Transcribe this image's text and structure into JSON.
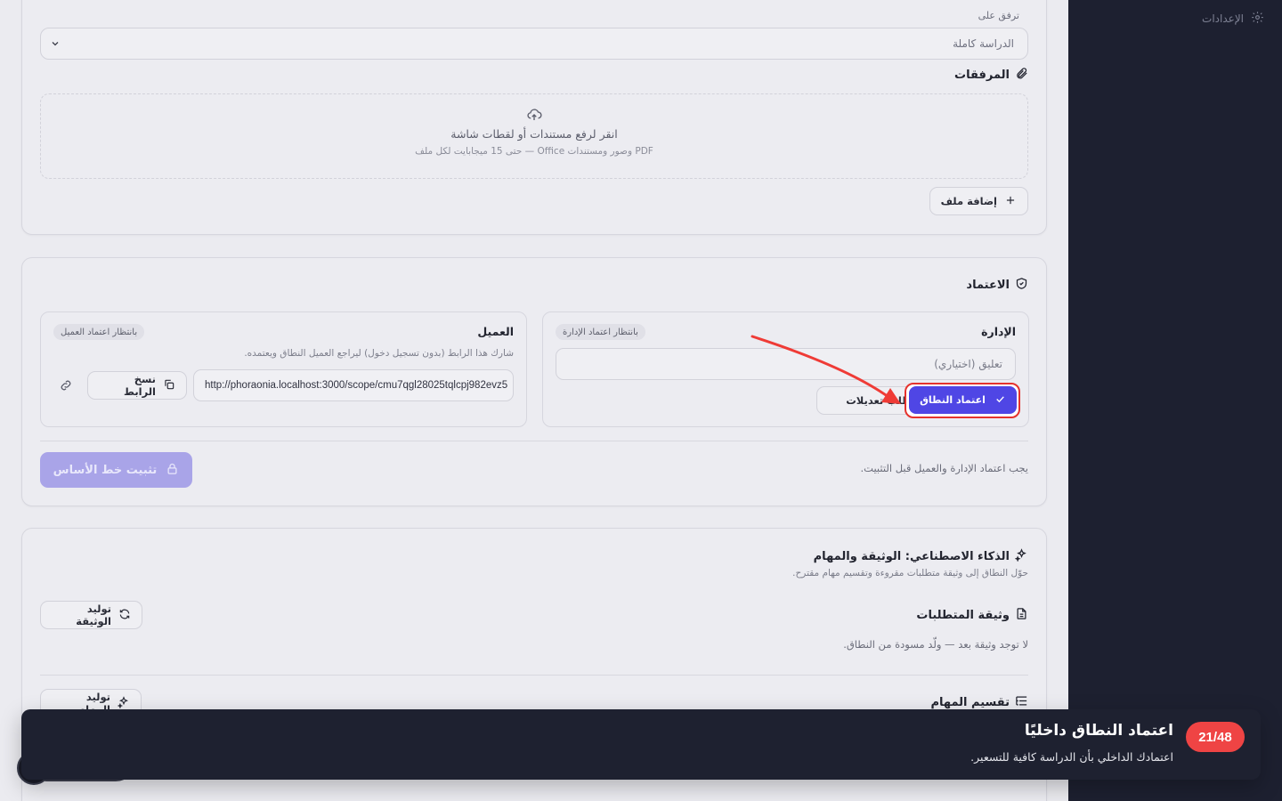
{
  "sidebar": {
    "settings_label": "الإعدادات"
  },
  "attach_section": {
    "attach_to_label": "ترفق على",
    "attach_to_value": "الدراسة كاملة",
    "attachments_title": "المرفقات",
    "dropzone_main": "انقر لرفع مستندات أو لقطات شاشة",
    "dropzone_sub": "PDF وصور ومستندات Office — حتى 15 ميجابايت لكل ملف",
    "add_file_label": "إضافة ملف"
  },
  "approval_section": {
    "title": "الاعتماد",
    "client": {
      "title": "العميل",
      "badge": "بانتظار اعتماد العميل",
      "hint": "شارك هذا الرابط (بدون تسجيل دخول) ليراجع العميل النطاق ويعتمده.",
      "url": "http://phoraonia.localhost:3000/scope/cmu7qgl28025tqlcpj982evz5",
      "copy_link_label": "نسخ الرابط"
    },
    "management": {
      "title": "الإدارة",
      "badge": "بانتظار اعتماد الإدارة",
      "comment_placeholder": "تعليق (اختياري)",
      "request_changes_label": "طلب تعديلات",
      "approve_label": "اعتماد النطاق"
    },
    "lock_baseline_label": "تثبيت خط الأساس",
    "lock_hint": "يجب اعتماد الإدارة والعميل قبل التثبيت."
  },
  "ai_section": {
    "title": "الذكاء الاصطناعي: الوثيقة والمهام",
    "subtitle": "حوّل النطاق إلى وثيقة متطلبات مقروءة وتقسيم مهام مقترح.",
    "requirements_title": "وثيقة المتطلبات",
    "generate_doc_label": "توليد الوثيقة",
    "no_doc_text": "لا توجد وثيقة بعد — ولّد مسودة من النطاق.",
    "tasks_title": "تقسيم المهام",
    "generate_tasks_label": "توليد المهام"
  },
  "toast": {
    "counter": "21/48",
    "title": "اعتماد النطاق داخليًا",
    "body": "اعتمادك الداخلي بأن الدراسة كافية للتسعير."
  },
  "colors": {
    "accent": "#4f46e5",
    "highlight": "#e5322d",
    "toast_bg": "#1e2130",
    "badge_red": "#ef4444"
  }
}
